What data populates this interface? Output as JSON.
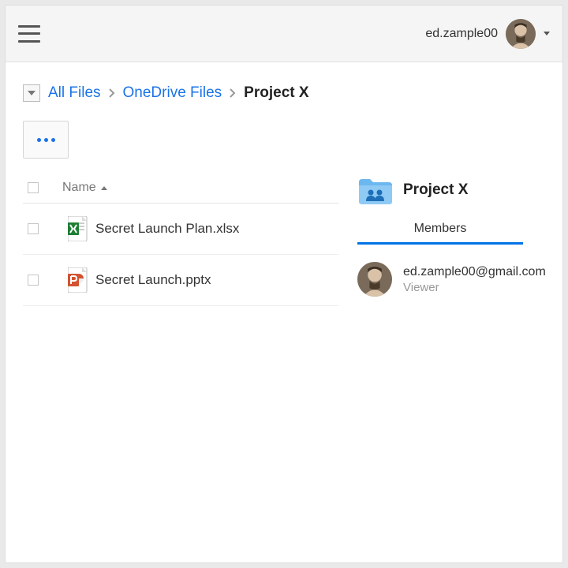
{
  "header": {
    "user_display": "ed.zample00"
  },
  "breadcrumb": {
    "root": "All Files",
    "parent": "OneDrive Files",
    "current": "Project X"
  },
  "columns": {
    "name": "Name"
  },
  "files": [
    {
      "name": "Secret Launch Plan.xlsx",
      "type": "xlsx"
    },
    {
      "name": "Secret Launch.pptx",
      "type": "pptx"
    }
  ],
  "side_panel": {
    "title": "Project X",
    "tab_members": "Members",
    "members": [
      {
        "email": "ed.zample00@gmail.com",
        "role": "Viewer"
      }
    ]
  }
}
